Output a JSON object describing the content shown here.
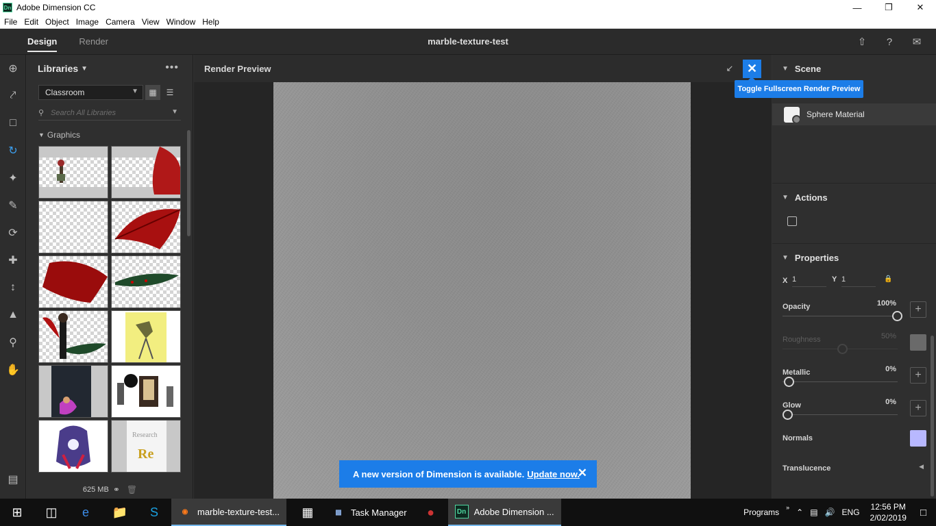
{
  "window": {
    "title": "Adobe Dimension CC",
    "app_icon": "Dn"
  },
  "menu": [
    "File",
    "Edit",
    "Object",
    "Image",
    "Camera",
    "View",
    "Window",
    "Help"
  ],
  "header": {
    "tabs": [
      "Design",
      "Render"
    ],
    "active_tab": "Design",
    "document_title": "marble-texture-test"
  },
  "libraries": {
    "title": "Libraries",
    "selected_library": "Classroom",
    "search_placeholder": "Search All Libraries",
    "section_title": "Graphics",
    "storage": "625 MB"
  },
  "preview": {
    "title": "Render Preview",
    "tooltip": "Toggle Fullscreen Render Preview"
  },
  "update_banner": {
    "text": "A new version of Dimension is available.",
    "link": "Update now."
  },
  "scene": {
    "title": "Scene",
    "item": "Sphere Material"
  },
  "actions": {
    "title": "Actions"
  },
  "properties": {
    "title": "Properties",
    "x_label": "X",
    "x_value": "1",
    "y_label": "Y",
    "y_value": "1",
    "opacity": {
      "label": "Opacity",
      "value": "100%",
      "level": 1.0
    },
    "roughness": {
      "label": "Roughness",
      "value": "50%",
      "level": 0.5
    },
    "metallic": {
      "label": "Metallic",
      "value": "0%",
      "level": 0.0
    },
    "glow": {
      "label": "Glow",
      "value": "0%",
      "level": 0.0
    },
    "normals": {
      "label": "Normals",
      "color": "#b8b8ff"
    },
    "translucence": {
      "label": "Translucence"
    }
  },
  "taskbar": {
    "apps": [
      "marble-texture-test...",
      "Task Manager",
      "Adobe Dimension ..."
    ],
    "programs_label": "Programs",
    "lang": "ENG",
    "time": "12:56 PM",
    "date": "2/02/2019"
  },
  "colors": {
    "accent": "#1c7de8",
    "panel": "#2f2f2f",
    "canvas": "#8f8f8f"
  }
}
